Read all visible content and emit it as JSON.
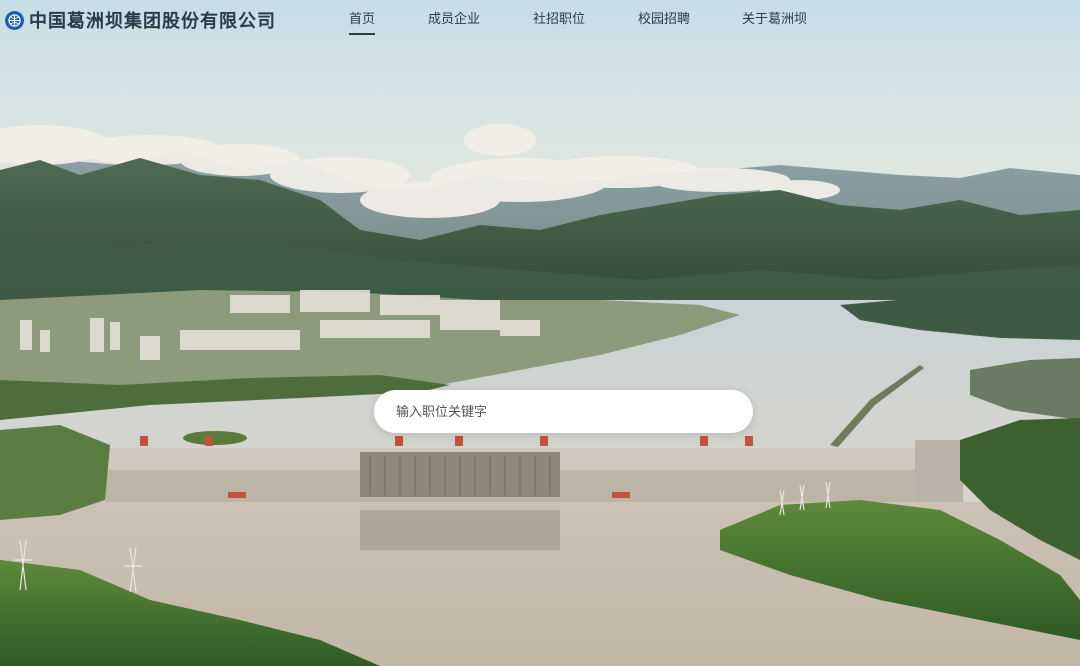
{
  "brand": {
    "name": "中国葛洲坝集团股份有限公司",
    "logo_icon": "cggc-globe-logo-icon",
    "logo_color": "#1f5fa9"
  },
  "nav": {
    "items": [
      {
        "label": "首页",
        "active": true
      },
      {
        "label": "成员企业",
        "active": false
      },
      {
        "label": "社招职位",
        "active": false
      },
      {
        "label": "校园招聘",
        "active": false
      },
      {
        "label": "关于葛洲坝",
        "active": false
      }
    ]
  },
  "search": {
    "placeholder": "输入职位关键字",
    "value": ""
  },
  "hero": {
    "image": "three-gorges-dam-landscape"
  }
}
